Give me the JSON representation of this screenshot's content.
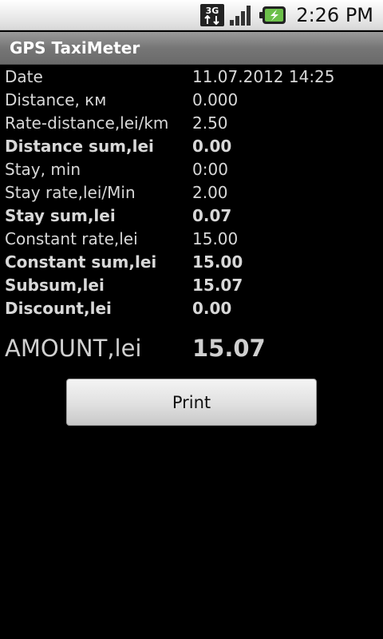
{
  "status_bar": {
    "network_label": "3G",
    "time": "2:26 PM"
  },
  "app": {
    "title": "GPS TaxiMeter"
  },
  "receipt": {
    "rows": [
      {
        "label": "Date",
        "value": "11.07.2012 14:25",
        "bold": false
      },
      {
        "label": "Distance, км",
        "value": "0.000",
        "bold": false
      },
      {
        "label": "Rate-distance,lei/km",
        "value": "2.50",
        "bold": false
      },
      {
        "label": "Distance sum,lei",
        "value": "0.00",
        "bold": true
      },
      {
        "label": "Stay, min",
        "value": "0:00",
        "bold": false
      },
      {
        "label": "Stay rate,lei/Min",
        "value": "2.00",
        "bold": false
      },
      {
        "label": "Stay sum,lei",
        "value": "0.07",
        "bold": true
      },
      {
        "label": "Constant rate,lei",
        "value": "15.00",
        "bold": false
      },
      {
        "label": "Constant sum,lei",
        "value": "15.00",
        "bold": true
      },
      {
        "label": "Subsum,lei",
        "value": "15.07",
        "bold": true
      },
      {
        "label": "Discount,lei",
        "value": "0.00",
        "bold": true
      }
    ],
    "amount_label": "AMOUNT,lei",
    "amount_value": "15.07"
  },
  "actions": {
    "print_label": "Print"
  },
  "colors": {
    "background": "#000000",
    "text": "#d8d8d8",
    "title_bar": "#7a7a7a",
    "battery_accent": "#6cc04a"
  },
  "icons": {
    "network": "3g-data-icon",
    "signal": "signal-strength-icon",
    "battery": "battery-charging-icon"
  }
}
